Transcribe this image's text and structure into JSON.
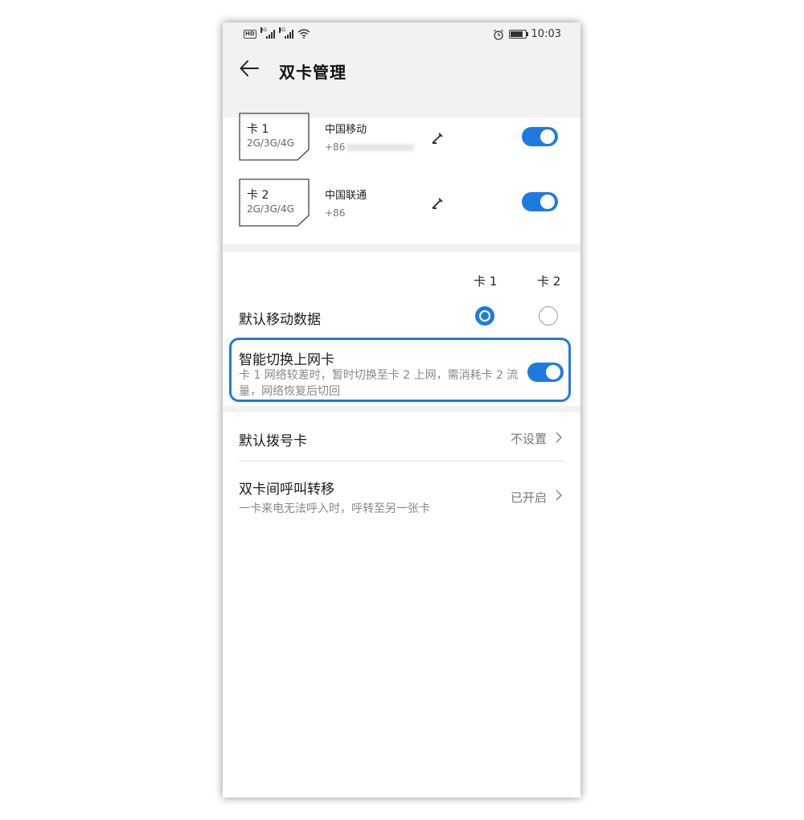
{
  "status_bar": {
    "hd": "HD",
    "net1": "4G",
    "net2": "4G",
    "time": "10:03"
  },
  "header": {
    "title": "双卡管理"
  },
  "sims": [
    {
      "card": "卡 1",
      "networks": "2G/3G/4G",
      "carrier": "中国移动",
      "number_prefix": "+86",
      "enabled": true
    },
    {
      "card": "卡 2",
      "networks": "2G/3G/4G",
      "carrier": "中国联通",
      "number_prefix": "+86",
      "enabled": true
    }
  ],
  "default_data": {
    "col1": "卡 1",
    "col2": "卡 2",
    "label": "默认移动数据",
    "selected": "卡 1"
  },
  "smart_switch": {
    "title": "智能切换上网卡",
    "desc": "卡 1 网络较差时，暂时切换至卡 2 上网，需消耗卡 2 流量，网络恢复后切回",
    "enabled": true
  },
  "default_dial": {
    "label": "默认拨号卡",
    "value": "不设置"
  },
  "call_forward": {
    "label": "双卡间呼叫转移",
    "sub": "一卡来电无法呼入时，呼转至另一张卡",
    "value": "已开启"
  },
  "colors": {
    "accent": "#1f7ae0",
    "header_bg": "#f2f2f2"
  }
}
